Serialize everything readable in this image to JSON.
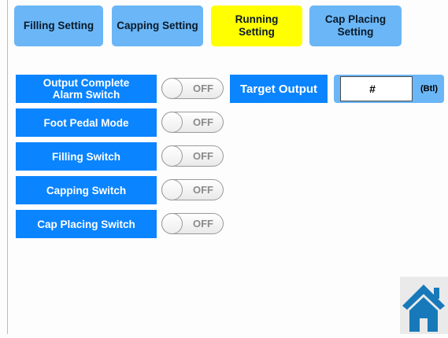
{
  "tabs": [
    {
      "label": "Filling Setting",
      "active": false
    },
    {
      "label": "Capping Setting",
      "active": false
    },
    {
      "label": "Running Setting",
      "active": true
    },
    {
      "label": "Cap Placing\nSetting",
      "active": false
    }
  ],
  "switches": [
    {
      "label": "Output Complete\nAlarm Switch",
      "state": "OFF"
    },
    {
      "label": "Foot Pedal Mode",
      "state": "OFF"
    },
    {
      "label": "Filling Switch",
      "state": "OFF"
    },
    {
      "label": "Capping Switch",
      "state": "OFF"
    },
    {
      "label": "Cap Placing Switch",
      "state": "OFF"
    }
  ],
  "target_output": {
    "label": "Target Output",
    "value": "#",
    "unit": "(Btl)"
  },
  "colors": {
    "tab": "#6bb6f6",
    "tab_active": "#ffff00",
    "label_box": "#0a84ff",
    "home_icon": "#1779b9"
  },
  "icons": {
    "home": "home-icon"
  }
}
